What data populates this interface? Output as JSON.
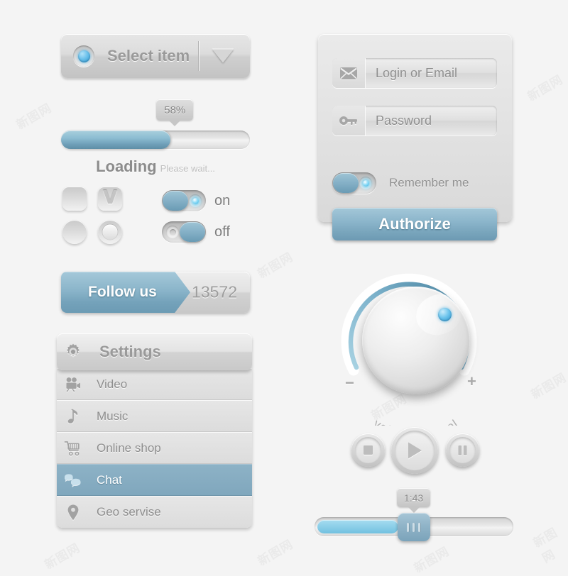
{
  "select": {
    "label": "Select item",
    "bullet_icon": "blue-dot-icon",
    "caret_icon": "chevron-down-icon"
  },
  "progress": {
    "tooltip": "58%",
    "percent": 58,
    "loading_label": "Loading",
    "wait_label": "Please wait..."
  },
  "controls": {
    "checkbox_unchecked_icon": "checkbox-empty-icon",
    "checkbox_checked_icon": "checkbox-check-icon",
    "check_glyph": "V",
    "radio_unselected_icon": "radio-empty-icon",
    "radio_selected_icon": "radio-filled-icon",
    "toggle_on_label": "on",
    "toggle_off_label": "off",
    "toggle_on_state": true,
    "toggle_off_state": false
  },
  "follow": {
    "label": "Follow us",
    "count": "13572"
  },
  "settings": {
    "title": "Settings",
    "header_icon": "gear-icon",
    "items": [
      {
        "label": "Video",
        "icon": "video-camera-icon",
        "active": false
      },
      {
        "label": "Music",
        "icon": "music-note-icon",
        "active": false
      },
      {
        "label": "Online shop",
        "icon": "shopping-cart-icon",
        "active": false
      },
      {
        "label": "Chat",
        "icon": "chat-bubbles-icon",
        "active": true
      },
      {
        "label": "Geo servise",
        "icon": "map-pin-icon",
        "active": false
      }
    ]
  },
  "login": {
    "email_placeholder": "Login or Email",
    "email_value": "",
    "email_icon": "envelope-icon",
    "password_placeholder": "Password",
    "password_value": "",
    "password_icon": "key-icon",
    "remember_label": "Remember me",
    "remember_checked": true,
    "authorize_label": "Authorize"
  },
  "volume": {
    "caption": "volume control",
    "minus_label": "−",
    "plus_label": "+",
    "arc_value_deg": 232,
    "pointer_icon": "knob-pointer-icon"
  },
  "media": {
    "stop_icon": "stop-icon",
    "play_icon": "play-icon",
    "pause_icon": "pause-icon"
  },
  "time": {
    "tooltip": "1:43",
    "percent": 42,
    "handle_icon": "slider-grip-icon"
  },
  "colors": {
    "accent_blue": "#8ab4ca",
    "accent_cyan": "#72c1e0",
    "panel_grey": "#e2e2e2",
    "text_grey": "#8e8e8e",
    "background": "#f4f4f4"
  },
  "watermark": {
    "text": "新图网"
  }
}
